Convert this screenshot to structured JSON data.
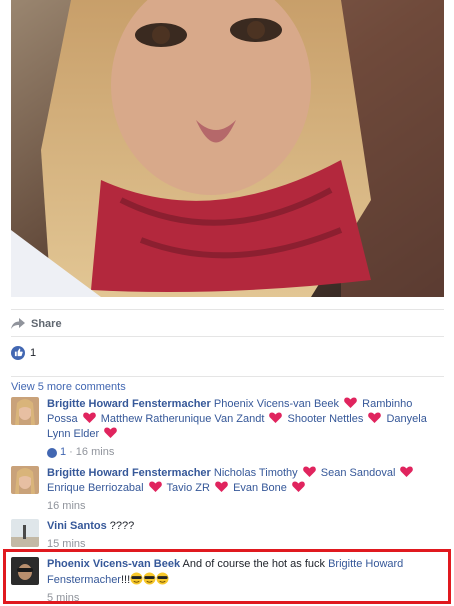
{
  "actions": {
    "share_label": "Share"
  },
  "likes": {
    "count": "1"
  },
  "comments_section": {
    "view_more_label": "View 5 more comments"
  },
  "comments": [
    {
      "author": "Brigitte Howard Fenstermacher",
      "tags": [
        "Phoenix Vicens-van Beek",
        "Rambinho Possa",
        "Matthew Ratherunique Van Zandt",
        "Shooter Nettles",
        "Danyela Lynn Elder"
      ],
      "like_count": "1",
      "time": "16 mins"
    },
    {
      "author": "Brigitte Howard Fenstermacher",
      "tags": [
        "Nicholas Timothy",
        "Sean Sandoval",
        "Enrique Berriozabal",
        "Tavio ZR",
        "Evan Bone"
      ],
      "time": "16 mins"
    },
    {
      "author": "Vini Santos",
      "text": "????",
      "time": "15 mins"
    },
    {
      "author": "Phoenix Vicens-van Beek",
      "text": "And of course the hot as fuck",
      "tag": "Brigitte Howard Fenstermacher",
      "text_after": "!!!",
      "time": "5 mins"
    }
  ],
  "colors": {
    "link": "#365899",
    "brand": "#4267b2",
    "heart": "#e0245e",
    "highlight": "#e0191f",
    "meta": "#90949c"
  }
}
